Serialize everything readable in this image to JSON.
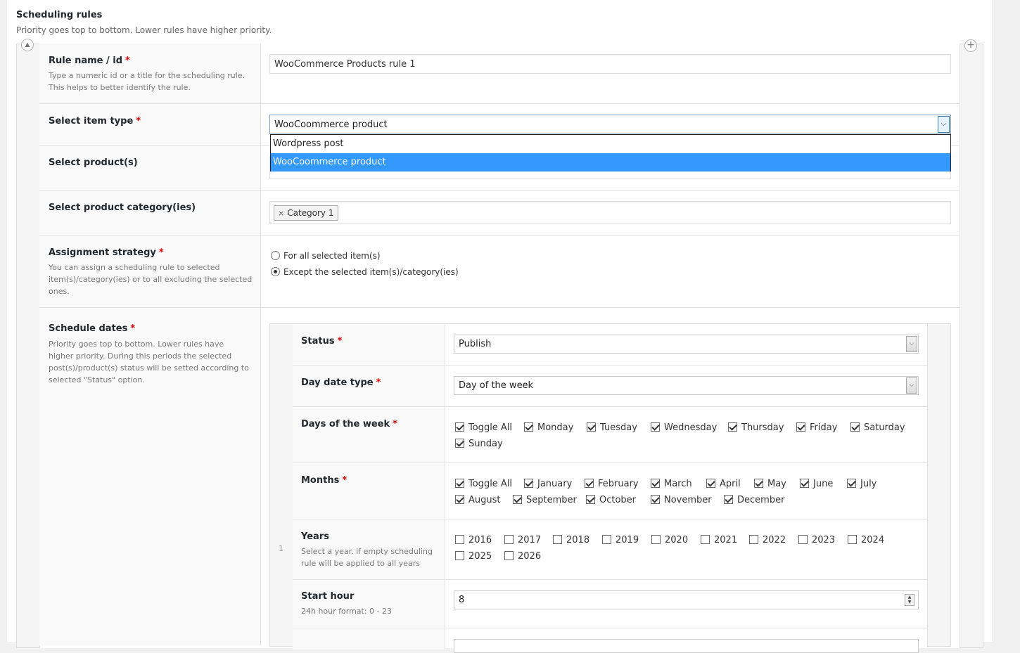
{
  "section": {
    "title": "Scheduling rules",
    "description": "Priority goes top to bottom. Lower rules have higher priority."
  },
  "controls": {
    "collapse_icon": "triangle-up-icon",
    "add_icon": "plus-icon"
  },
  "rule": {
    "name": {
      "label": "Rule name / id",
      "required": "*",
      "desc1": "Type a numeric id or a title for the scheduling rule.",
      "desc2": "This helps to better identify the rule.",
      "value": "WooCommerce Products rule 1"
    },
    "item_type": {
      "label": "Select item type",
      "required": "*",
      "value": "WooCoommerce product",
      "options": [
        "Wordpress post",
        "WooCoommerce product"
      ]
    },
    "products": {
      "label": "Select product(s)"
    },
    "categories": {
      "label": "Select product category(ies)",
      "tags": [
        "Category 1"
      ],
      "remove_glyph": "×"
    },
    "assignment": {
      "label": "Assignment strategy",
      "required": "*",
      "desc1": "You can assign a scheduling rule to selected",
      "desc2": "item(s)/category(ies) or to all excluding the selected",
      "desc3": "ones.",
      "options": [
        "For all selected item(s)",
        "Except the selected item(s)/category(ies)"
      ],
      "selected_index": 1
    },
    "schedule": {
      "label": "Schedule dates",
      "required": "*",
      "desc1": "Priority goes top to bottom. Lower rules have",
      "desc2": "higher priority. During this periods the selected",
      "desc3": "post(s)/product(s) status will be setted according to",
      "desc4": "selected \"Status\" option.",
      "index": "1",
      "status": {
        "label": "Status",
        "required": "*",
        "value": "Publish"
      },
      "day_type": {
        "label": "Day date type",
        "required": "*",
        "value": "Day of the week"
      },
      "days": {
        "label": "Days of the week",
        "required": "*",
        "items": [
          "Toggle All",
          "Monday",
          "Tuesday",
          "Wednesday",
          "Thursday",
          "Friday",
          "Saturday",
          "Sunday"
        ],
        "checked": [
          true,
          true,
          true,
          true,
          true,
          true,
          true,
          true
        ]
      },
      "months": {
        "label": "Months",
        "required": "*",
        "items": [
          "Toggle All",
          "January",
          "February",
          "March",
          "April",
          "May",
          "June",
          "July",
          "August",
          "September",
          "October",
          "November",
          "December"
        ],
        "checked": [
          true,
          true,
          true,
          true,
          true,
          true,
          true,
          true,
          true,
          true,
          true,
          true,
          true
        ]
      },
      "years": {
        "label": "Years",
        "desc1": "Select a year. if empty scheduling",
        "desc2": "rule will be applied to all years",
        "items": [
          "2016",
          "2017",
          "2018",
          "2019",
          "2020",
          "2021",
          "2022",
          "2023",
          "2024",
          "2025",
          "2026"
        ],
        "checked": [
          false,
          false,
          false,
          false,
          false,
          false,
          false,
          false,
          false,
          false,
          false
        ]
      },
      "start_hour": {
        "label": "Start hour",
        "desc": "24h hour format: 0 - 23",
        "value": "8"
      }
    }
  }
}
